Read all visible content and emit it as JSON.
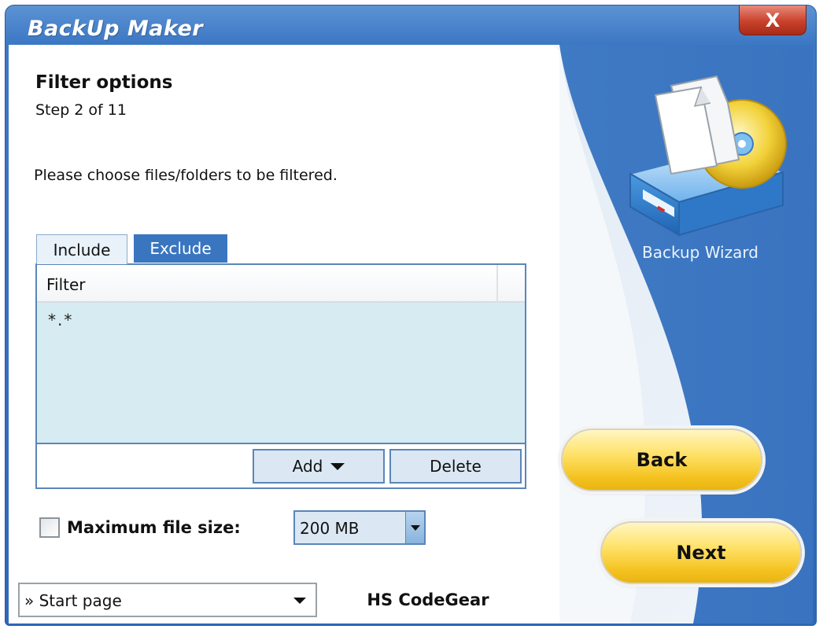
{
  "window": {
    "title": "BackUp Maker",
    "close_label": "X"
  },
  "page": {
    "heading": "Filter options",
    "step": "Step 2 of 11",
    "instruction": "Please choose files/folders to be filtered."
  },
  "tabs": [
    {
      "label": "Include",
      "active": true
    },
    {
      "label": "Exclude",
      "active": false
    }
  ],
  "filter_list": {
    "column_header": "Filter",
    "items": [
      "*.*"
    ],
    "add_label": "Add",
    "delete_label": "Delete"
  },
  "max_file_size": {
    "label": "Maximum file size:",
    "checked": false,
    "value": "200 MB"
  },
  "bottom": {
    "start_select_value": "» Start page",
    "brand": "HS CodeGear"
  },
  "wizard": {
    "caption": "Backup Wizard"
  },
  "nav": {
    "back_label": "Back",
    "next_label": "Next"
  },
  "colors": {
    "window_blue": "#3d78c4",
    "list_body": "#d7ebf2",
    "button_yellow": "#ffe26a",
    "tab_exclude": "#3a76c0",
    "close_red": "#c9412c"
  }
}
